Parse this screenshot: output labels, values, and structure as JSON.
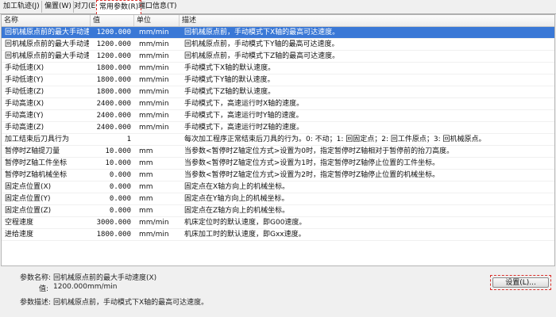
{
  "tabs": [
    {
      "label": "加工轨迹(J)"
    },
    {
      "label": "偏置(W)"
    },
    {
      "label": "对刀(E)"
    },
    {
      "label": "常用参数(R)"
    },
    {
      "label": "端口信息(T)"
    }
  ],
  "table": {
    "headers": {
      "name": "名称",
      "value": "值",
      "unit": "单位",
      "desc": "描述"
    },
    "rows": [
      {
        "name": "回机械原点前的最大手动速度(X)",
        "value": "1200.000",
        "unit": "mm/min",
        "desc": "回机械原点前，手动模式下X轴的最高可达速度。"
      },
      {
        "name": "回机械原点前的最大手动速度(Y)",
        "value": "1200.000",
        "unit": "mm/min",
        "desc": "回机械原点前，手动模式下Y轴的最高可达速度。"
      },
      {
        "name": "回机械原点前的最大手动速度(Z)",
        "value": "1200.000",
        "unit": "mm/min",
        "desc": "回机械原点前，手动模式下Z轴的最高可达速度。"
      },
      {
        "name": "手动低速(X)",
        "value": "1800.000",
        "unit": "mm/min",
        "desc": "手动模式下X轴的默认速度。"
      },
      {
        "name": "手动低速(Y)",
        "value": "1800.000",
        "unit": "mm/min",
        "desc": "手动模式下Y轴的默认速度。"
      },
      {
        "name": "手动低速(Z)",
        "value": "1800.000",
        "unit": "mm/min",
        "desc": "手动模式下Z轴的默认速度。"
      },
      {
        "name": "手动高速(X)",
        "value": "2400.000",
        "unit": "mm/min",
        "desc": "手动模式下，高速运行时X轴的速度。"
      },
      {
        "name": "手动高速(Y)",
        "value": "2400.000",
        "unit": "mm/min",
        "desc": "手动模式下，高速运行时Y轴的速度。"
      },
      {
        "name": "手动高速(Z)",
        "value": "2400.000",
        "unit": "mm/min",
        "desc": "手动模式下，高速运行时Z轴的速度。"
      },
      {
        "name": "加工结束后刀具行为",
        "value": "1",
        "unit": "",
        "desc": "每次加工程序正常结束后刀具的行为。0: 不动；1: 回固定点；2: 回工件原点；3: 回机械原点。"
      },
      {
        "name": "暂停时Z轴提刀量",
        "value": "10.000",
        "unit": "mm",
        "desc": "当参数<暂停时Z轴定位方式>设置为0时，指定暂停时Z轴相对于暂停前的抬刀高度。"
      },
      {
        "name": "暂停时Z轴工件坐标",
        "value": "10.000",
        "unit": "mm",
        "desc": "当参数<暂停时Z轴定位方式>设置为1时，指定暂停时Z轴停止位置的工件坐标。"
      },
      {
        "name": "暂停时Z轴机械坐标",
        "value": "0.000",
        "unit": "mm",
        "desc": "当参数<暂停时Z轴定位方式>设置为2时，指定暂停时Z轴停止位置的机械坐标。"
      },
      {
        "name": "固定点位置(X)",
        "value": "0.000",
        "unit": "mm",
        "desc": "固定点在X轴方向上的机械坐标。"
      },
      {
        "name": "固定点位置(Y)",
        "value": "0.000",
        "unit": "mm",
        "desc": "固定点在Y轴方向上的机械坐标。"
      },
      {
        "name": "固定点位置(Z)",
        "value": "0.000",
        "unit": "mm",
        "desc": "固定点在Z轴方向上的机械坐标。"
      },
      {
        "name": "空程速度",
        "value": "3000.000",
        "unit": "mm/min",
        "desc": "机床定位时的默认速度，即G00速度。"
      },
      {
        "name": "进给速度",
        "value": "1800.000",
        "unit": "mm/min",
        "desc": "机床加工时的默认速度，即Gxx速度。"
      }
    ]
  },
  "info": {
    "name_label": "参数名称:",
    "name_value": "回机械原点前的最大手动速度(X)",
    "value_label": "值:",
    "value_value": "1200.000mm/min",
    "desc_label": "参数描述:",
    "desc_value": "回机械原点前，手动模式下X轴的最高可达速度。"
  },
  "buttons": {
    "set": "设置(L)..."
  },
  "colors": {
    "selection": "#3a78d6",
    "highlight_dash": "#d9302b"
  }
}
